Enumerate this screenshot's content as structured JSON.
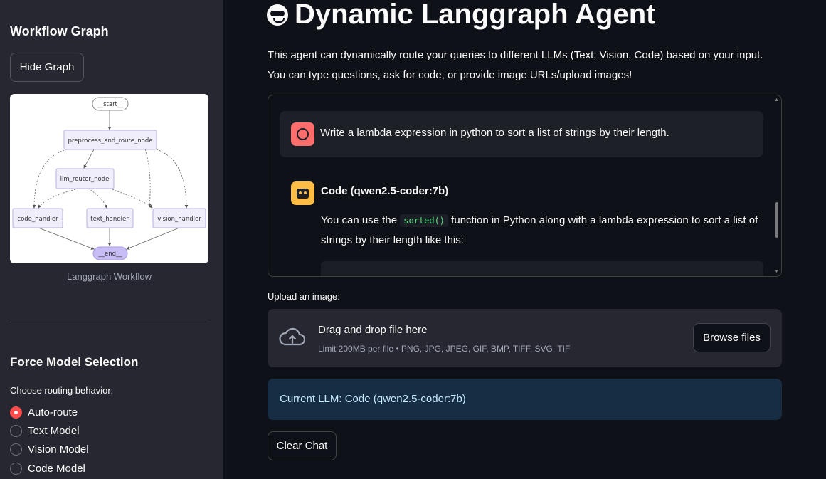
{
  "sidebar": {
    "workflow_title": "Workflow Graph",
    "hide_graph_label": "Hide Graph",
    "graph_caption": "Langgraph Workflow",
    "graph_nodes": {
      "start": "__start__",
      "preprocess": "preprocess_and_route_node",
      "router": "llm_router_node",
      "code": "code_handler",
      "text": "text_handler",
      "vision": "vision_handler",
      "end": "__end__"
    },
    "force_title": "Force Model Selection",
    "routing_label": "Choose routing behavior:",
    "options": [
      {
        "label": "Auto-route",
        "selected": true
      },
      {
        "label": "Text Model",
        "selected": false
      },
      {
        "label": "Vision Model",
        "selected": false
      },
      {
        "label": "Code Model",
        "selected": false
      }
    ]
  },
  "main": {
    "title": "Dynamic Langgraph Agent",
    "intro_line1": "This agent can dynamically route your queries to different LLMs (Text, Vision, Code) based on your input.",
    "intro_line2": "You can type questions, ask for code, or provide image URLs/upload images!",
    "chat": {
      "user_message": "Write a lambda expression in python to sort a list of strings by their length.",
      "bot_name": "Code (qwen2.5-coder:7b)",
      "bot_text_before": "You can use the ",
      "bot_code": "sorted()",
      "bot_text_after": " function in Python along with a lambda expression to sort a list of strings by their length like this:"
    },
    "upload": {
      "label": "Upload an image:",
      "drop_title": "Drag and drop file here",
      "limit": "Limit 200MB per file • PNG, JPG, JPEG, GIF, BMP, TIFF, SVG, TIF",
      "browse_label": "Browse files"
    },
    "current_llm": "Current LLM: Code (qwen2.5-coder:7b)",
    "clear_label": "Clear Chat"
  },
  "colors": {
    "accent": "#ff4b4b",
    "user_avatar": "#ff6c6c",
    "bot_avatar": "#ffbd45",
    "info_bg": "#172d43"
  }
}
